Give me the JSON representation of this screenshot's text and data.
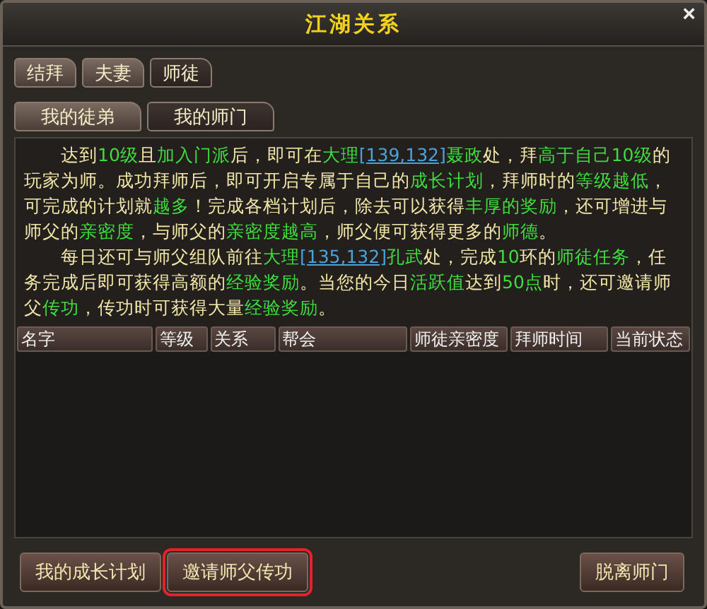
{
  "window": {
    "title": "江湖关系",
    "close": "×"
  },
  "tabs": [
    {
      "label": "结拜",
      "selected": false
    },
    {
      "label": "夫妻",
      "selected": false
    },
    {
      "label": "师徒",
      "selected": true
    }
  ],
  "subtabs": [
    {
      "label": "我的徒弟",
      "selected": false
    },
    {
      "label": "我的师门",
      "selected": true
    }
  ],
  "paragraphs": [
    [
      {
        "kind": "text",
        "text": "达到"
      },
      {
        "kind": "highlight",
        "text": "10级"
      },
      {
        "kind": "text",
        "text": "且"
      },
      {
        "kind": "highlight",
        "text": "加入门派"
      },
      {
        "kind": "text",
        "text": "后，即可在"
      },
      {
        "kind": "highlight",
        "text": "大理"
      },
      {
        "kind": "coord",
        "text": "[139,132]"
      },
      {
        "kind": "highlight",
        "text": "聂政"
      },
      {
        "kind": "text",
        "text": "处，拜"
      },
      {
        "kind": "highlight",
        "text": "高于自己10级"
      },
      {
        "kind": "text",
        "text": "的玩家为师。成功拜师后，即可开启专属于自己的"
      },
      {
        "kind": "highlight",
        "text": "成长计划"
      },
      {
        "kind": "text",
        "text": "，拜师时的"
      },
      {
        "kind": "highlight",
        "text": "等级越低"
      },
      {
        "kind": "text",
        "text": "，可完成的计划就"
      },
      {
        "kind": "highlight",
        "text": "越多"
      },
      {
        "kind": "text",
        "text": "！完成各档计划后，除去可以获得"
      },
      {
        "kind": "highlight",
        "text": "丰厚的奖励"
      },
      {
        "kind": "text",
        "text": "，还可增进与师父的"
      },
      {
        "kind": "highlight",
        "text": "亲密度"
      },
      {
        "kind": "text",
        "text": "，与师父的"
      },
      {
        "kind": "highlight",
        "text": "亲密度越高"
      },
      {
        "kind": "text",
        "text": "，师父便可获得更多的"
      },
      {
        "kind": "highlight",
        "text": "师德"
      },
      {
        "kind": "text",
        "text": "。"
      }
    ],
    [
      {
        "kind": "text",
        "text": "每日还可与师父组队前往"
      },
      {
        "kind": "highlight",
        "text": "大理"
      },
      {
        "kind": "coord",
        "text": "[135,132]"
      },
      {
        "kind": "highlight",
        "text": "孔武"
      },
      {
        "kind": "text",
        "text": "处，完成"
      },
      {
        "kind": "highlight",
        "text": "10"
      },
      {
        "kind": "text",
        "text": "环的"
      },
      {
        "kind": "highlight",
        "text": "师徒任务"
      },
      {
        "kind": "text",
        "text": "，任务完成后即可获得高额的"
      },
      {
        "kind": "highlight",
        "text": "经验奖励"
      },
      {
        "kind": "text",
        "text": "。当您的今日"
      },
      {
        "kind": "highlight",
        "text": "活跃值"
      },
      {
        "kind": "text",
        "text": "达到"
      },
      {
        "kind": "highlight",
        "text": "50点"
      },
      {
        "kind": "text",
        "text": "时，还可邀请师父"
      },
      {
        "kind": "highlight",
        "text": "传功"
      },
      {
        "kind": "text",
        "text": "，传功时可获得大量"
      },
      {
        "kind": "highlight",
        "text": "经验奖励"
      },
      {
        "kind": "text",
        "text": "。"
      }
    ]
  ],
  "table": {
    "columns": [
      "名字",
      "等级",
      "关系",
      "帮会",
      "师徒亲密度",
      "拜师时间",
      "当前状态"
    ]
  },
  "buttons": [
    {
      "label": "我的成长计划",
      "highlighted": false
    },
    {
      "label": "邀请师父传功",
      "highlighted": true
    },
    {
      "label": "脱离师门",
      "highlighted": false
    }
  ]
}
